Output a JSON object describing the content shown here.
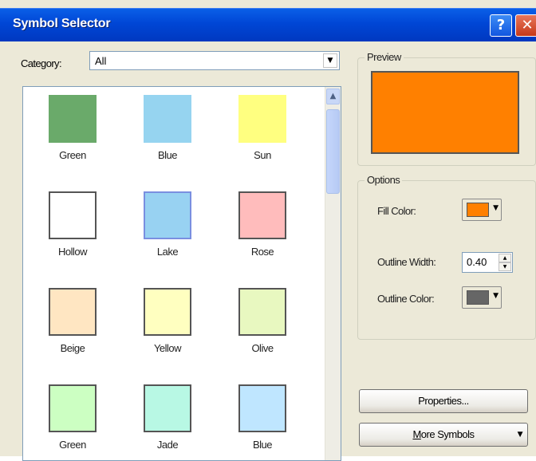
{
  "window": {
    "title": "Symbol Selector",
    "help_glyph": "?",
    "close_glyph": "✕"
  },
  "category": {
    "label": "Category:",
    "value": "All"
  },
  "symbols": [
    {
      "name": "Green",
      "fill": "#6aaa6a",
      "outline": "none"
    },
    {
      "name": "Blue",
      "fill": "#96d4f0",
      "outline": "none"
    },
    {
      "name": "Sun",
      "fill": "#ffff80",
      "outline": "none"
    },
    {
      "name": "Hollow",
      "fill": "#ffffff",
      "outline": "#555555"
    },
    {
      "name": "Lake",
      "fill": "#98d2f2",
      "outline": "#7a8fe0"
    },
    {
      "name": "Rose",
      "fill": "#ffbcbc",
      "outline": "#555555"
    },
    {
      "name": "Beige",
      "fill": "#ffe6c2",
      "outline": "#555555"
    },
    {
      "name": "Yellow",
      "fill": "#ffffc0",
      "outline": "#555555"
    },
    {
      "name": "Olive",
      "fill": "#e8f8c0",
      "outline": "#555555"
    },
    {
      "name": "Green",
      "fill": "#ccffc2",
      "outline": "#555555"
    },
    {
      "name": "Jade",
      "fill": "#b8f8e4",
      "outline": "#555555"
    },
    {
      "name": "Blue",
      "fill": "#bfe6ff",
      "outline": "#555555"
    }
  ],
  "preview": {
    "label": "Preview",
    "fill": "#ff8000"
  },
  "options": {
    "label": "Options",
    "fill_color_label": "Fill Color:",
    "fill_color": "#ff8000",
    "outline_width_label": "Outline Width:",
    "outline_width": "0.40",
    "outline_color_label": "Outline Color:",
    "outline_color": "#666666"
  },
  "buttons": {
    "properties": "Properties...",
    "more_symbols_prefix": "M",
    "more_symbols_rest": "ore Symbols"
  }
}
